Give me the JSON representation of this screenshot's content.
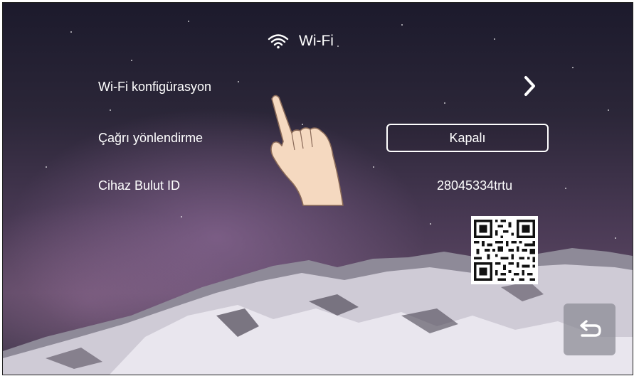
{
  "header": {
    "title": "Wi-Fi",
    "icon": "wifi-icon"
  },
  "rows": {
    "wifi_config": {
      "label": "Wi-Fi konfigürasyon",
      "icon": "chevron-right-icon"
    },
    "call_forwarding": {
      "label": "Çağrı yönlendirme",
      "value": "Kapalı"
    },
    "cloud_id": {
      "label": "Cihaz Bulut ID",
      "value": "28045334trtu"
    }
  },
  "qr": {
    "icon": "qr-code-icon"
  },
  "back": {
    "icon": "back-arrow-icon"
  },
  "overlay": {
    "icon": "pointing-hand-icon"
  }
}
